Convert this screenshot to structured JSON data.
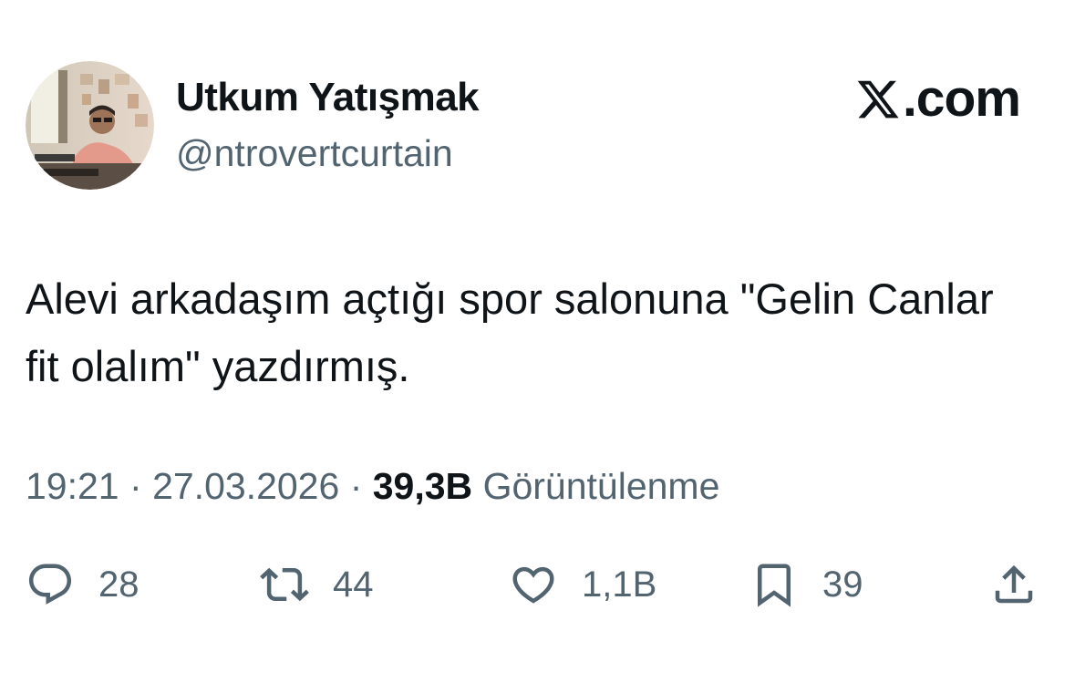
{
  "author": {
    "display_name": "Utkum Yatışmak",
    "handle": "@ntrovertcurtain"
  },
  "brand": {
    "text": ".com",
    "icon": "x-logo-icon"
  },
  "tweet": {
    "text": "Alevi arkadaşım açtığı spor salonuna \"Gelin Canlar fit olalım\" yazdırmış."
  },
  "meta": {
    "time": "19:21",
    "separator": "·",
    "date": "27.03.2026",
    "views_count": "39,3B",
    "views_label": "Görüntülenme"
  },
  "actions": {
    "reply": {
      "icon": "reply-icon",
      "count": "28"
    },
    "retweet": {
      "icon": "retweet-icon",
      "count": "44"
    },
    "like": {
      "icon": "heart-icon",
      "count": "1,1B"
    },
    "bookmark": {
      "icon": "bookmark-icon",
      "count": "39"
    },
    "share": {
      "icon": "share-icon"
    }
  },
  "colors": {
    "text_primary": "#0f1419",
    "text_secondary": "#536471",
    "background": "#ffffff"
  }
}
